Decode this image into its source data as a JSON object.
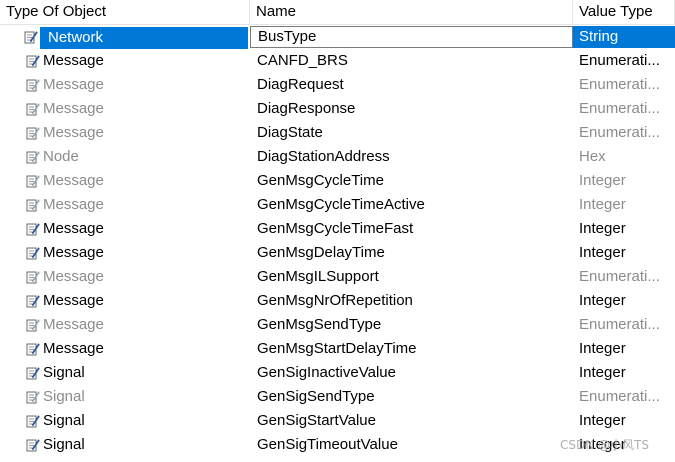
{
  "columns": {
    "type_of_object": "Type Of Object",
    "name": "Name",
    "value_type": "Value Type"
  },
  "rows": [
    {
      "type": "Network",
      "name": "BusType",
      "value_type": "String",
      "inactive": false,
      "selected": true
    },
    {
      "type": "Message",
      "name": "CANFD_BRS",
      "value_type": "Enumerati...",
      "inactive": false,
      "selected": false
    },
    {
      "type": "Message",
      "name": "DiagRequest",
      "value_type": "Enumerati...",
      "inactive": true,
      "selected": false
    },
    {
      "type": "Message",
      "name": "DiagResponse",
      "value_type": "Enumerati...",
      "inactive": true,
      "selected": false
    },
    {
      "type": "Message",
      "name": "DiagState",
      "value_type": "Enumerati...",
      "inactive": true,
      "selected": false
    },
    {
      "type": "Node",
      "name": "DiagStationAddress",
      "value_type": "Hex",
      "inactive": true,
      "selected": false
    },
    {
      "type": "Message",
      "name": "GenMsgCycleTime",
      "value_type": "Integer",
      "inactive": true,
      "selected": false
    },
    {
      "type": "Message",
      "name": "GenMsgCycleTimeActive",
      "value_type": "Integer",
      "inactive": true,
      "selected": false
    },
    {
      "type": "Message",
      "name": "GenMsgCycleTimeFast",
      "value_type": "Integer",
      "inactive": false,
      "selected": false
    },
    {
      "type": "Message",
      "name": "GenMsgDelayTime",
      "value_type": "Integer",
      "inactive": false,
      "selected": false
    },
    {
      "type": "Message",
      "name": "GenMsgILSupport",
      "value_type": "Enumerati...",
      "inactive": true,
      "selected": false
    },
    {
      "type": "Message",
      "name": "GenMsgNrOfRepetition",
      "value_type": "Integer",
      "inactive": false,
      "selected": false
    },
    {
      "type": "Message",
      "name": "GenMsgSendType",
      "value_type": "Enumerati...",
      "inactive": true,
      "selected": false
    },
    {
      "type": "Message",
      "name": "GenMsgStartDelayTime",
      "value_type": "Integer",
      "inactive": false,
      "selected": false
    },
    {
      "type": "Signal",
      "name": "GenSigInactiveValue",
      "value_type": "Integer",
      "inactive": false,
      "selected": false
    },
    {
      "type": "Signal",
      "name": "GenSigSendType",
      "value_type": "Enumerati...",
      "inactive": true,
      "selected": false
    },
    {
      "type": "Signal",
      "name": "GenSigStartValue",
      "value_type": "Integer",
      "inactive": false,
      "selected": false
    },
    {
      "type": "Signal",
      "name": "GenSigTimeoutValue",
      "value_type": "Integer",
      "inactive": false,
      "selected": false
    }
  ],
  "icon": "edit-attribute-icon",
  "colors": {
    "selection": "#0078d7",
    "inactive_text": "#8c8c8c",
    "icon_blue": "#2b579a"
  },
  "watermark": "CSDN @小风TS"
}
